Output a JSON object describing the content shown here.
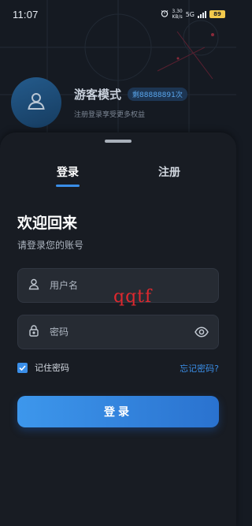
{
  "status_bar": {
    "time": "11:07",
    "net_speed_value": "3.30",
    "net_speed_unit": "KB/s",
    "network": "5G",
    "battery": "89"
  },
  "profile": {
    "title": "游客模式",
    "quota": "剩88888891次",
    "subtitle": "注册登录享受更多权益",
    "avatar_icon": "user-icon"
  },
  "tabs": [
    {
      "label": "登录",
      "active": true
    },
    {
      "label": "注册",
      "active": false
    }
  ],
  "welcome": {
    "title": "欢迎回来",
    "subtitle": "请登录您的账号"
  },
  "form": {
    "username_placeholder": "用户名",
    "password_placeholder": "密码",
    "remember_label": "记住密码",
    "remember_checked": true,
    "forgot_label": "忘记密码?",
    "submit_label": "登录"
  },
  "watermark": "qqtf",
  "colors": {
    "accent": "#3a8ee8",
    "background": "#151a22",
    "sheet": "#181c23",
    "field": "#262b33",
    "watermark": "#e0282e"
  }
}
